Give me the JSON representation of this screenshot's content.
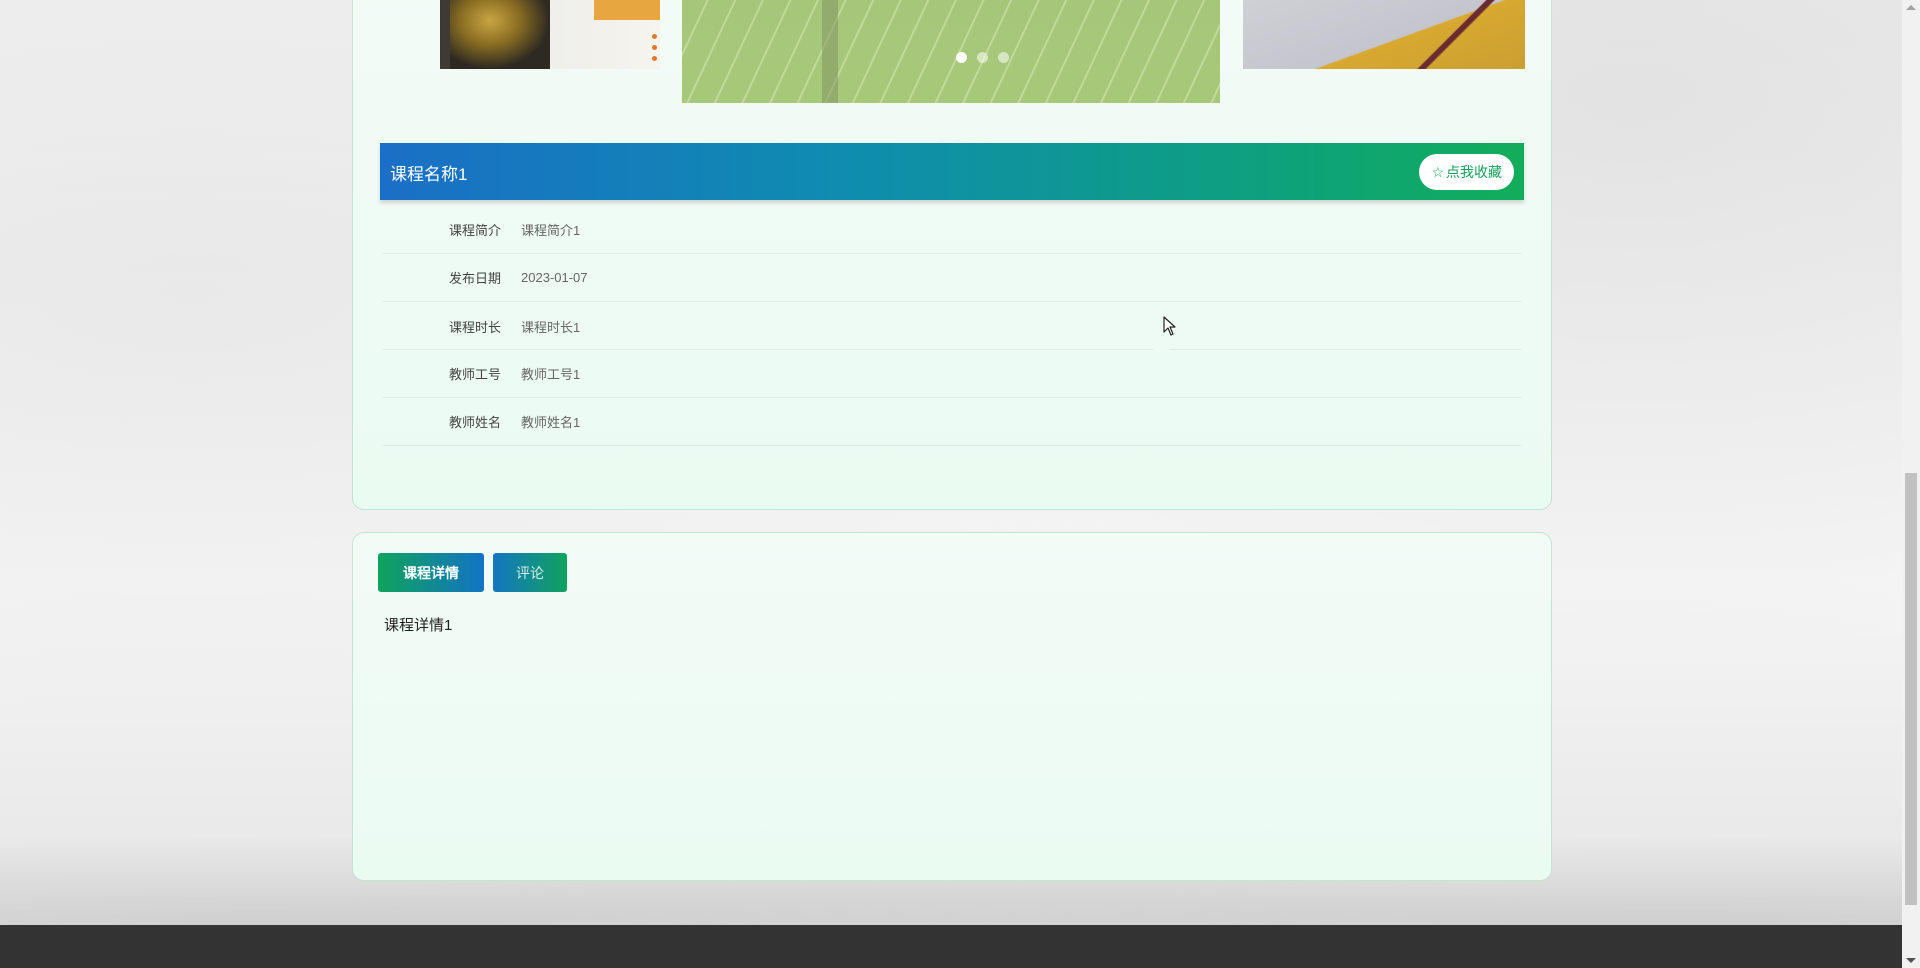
{
  "carousel": {
    "slide_count": 3,
    "active_index": 0
  },
  "course": {
    "title": "课程名称1",
    "favorite_label": "点我收藏",
    "fields": [
      {
        "label": "课程简介",
        "value": "课程简介1"
      },
      {
        "label": "发布日期",
        "value": "2023-01-07"
      },
      {
        "label": "课程时长",
        "value": "课程时长1"
      },
      {
        "label": "教师工号",
        "value": "教师工号1"
      },
      {
        "label": "教师姓名",
        "value": "教师姓名1"
      }
    ]
  },
  "tabs": [
    {
      "label": "课程详情",
      "active": true
    },
    {
      "label": "评论",
      "active": false
    }
  ],
  "detail": {
    "content": "课程详情1"
  },
  "colors": {
    "header_gradient_start": "#1a6fc6",
    "header_gradient_end": "#12ad5a",
    "accent_green": "#15a25a",
    "footer": "#333333"
  },
  "icons": {
    "favorite": "star-outline-icon",
    "cursor": "mouse-pointer-icon"
  }
}
